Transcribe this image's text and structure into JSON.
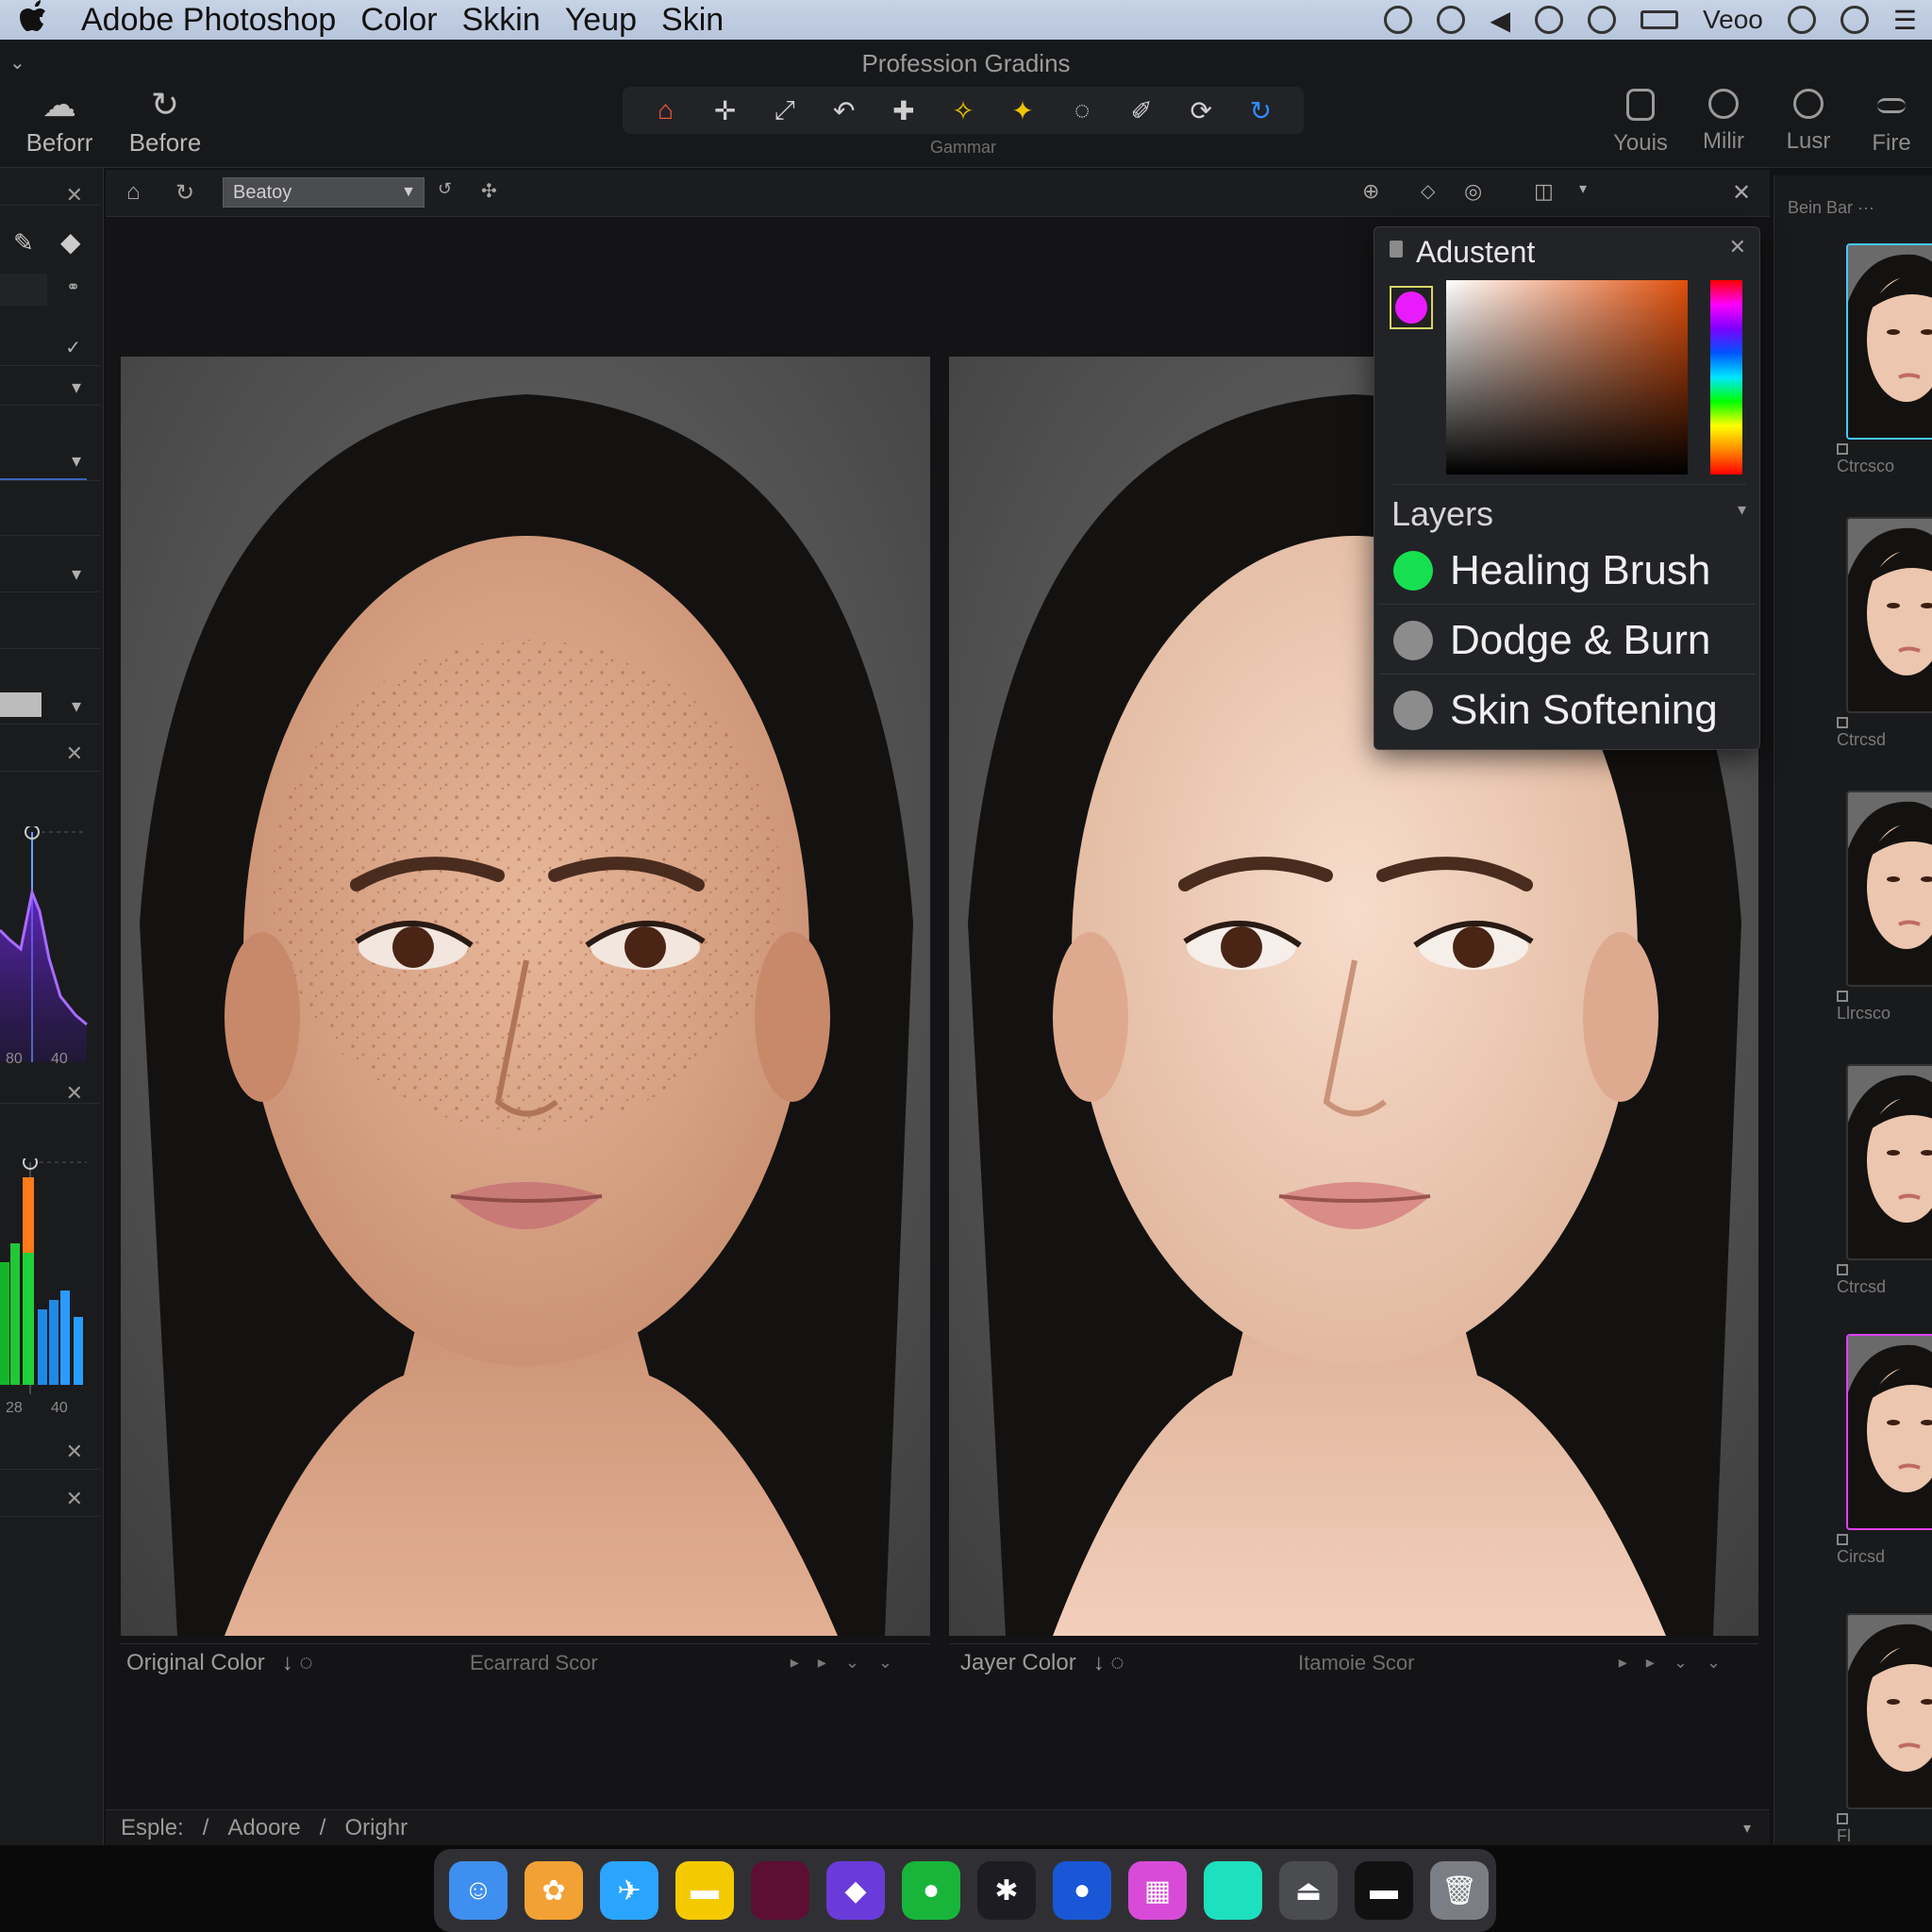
{
  "menubar": {
    "items": [
      "Adobe Photoshop",
      "Color",
      "Skkin",
      "Yeup",
      "Skin"
    ],
    "right_text": "Veoo"
  },
  "app": {
    "title": "Profession Gradins"
  },
  "toolbar": {
    "left_buttons": [
      "Beforr",
      "Before"
    ],
    "strip_label": "Gammar",
    "tools": [
      {
        "icon": "home-tool-icon",
        "color": "#ff5a3c"
      },
      {
        "icon": "move-tool-icon",
        "color": "#d0d0d0"
      },
      {
        "icon": "transform-tool-icon",
        "color": "#d0d0d0"
      },
      {
        "icon": "undo-tool-icon",
        "color": "#d0d0d0"
      },
      {
        "icon": "stamp-tool-icon",
        "color": "#d0d0d0"
      },
      {
        "icon": "spot-heal-tool-icon",
        "color": "#f0c400"
      },
      {
        "icon": "patch-tool-icon",
        "color": "#f0c400"
      },
      {
        "icon": "lasso-tool-icon",
        "color": "#d0d0d0"
      },
      {
        "icon": "pen-tool-icon",
        "color": "#d0d0d0"
      },
      {
        "icon": "rotate-tool-icon",
        "color": "#d0d0d0"
      },
      {
        "icon": "refresh-tool-icon",
        "color": "#2f8cff"
      }
    ],
    "right_buttons": [
      "Youis",
      "Milir",
      "Lusr",
      "Fire"
    ]
  },
  "docbar": {
    "preset_value": "Beatoy"
  },
  "left_panel": {
    "chart1": {
      "ticks": [
        "80",
        "40"
      ],
      "color": "#7b2cff"
    },
    "chart2": {
      "ticks": [
        "28",
        "40"
      ]
    }
  },
  "photos": {
    "left": {
      "caption": "Original Color",
      "caption_icon": "↓ ◌",
      "mid": "Ecarrard Scor"
    },
    "right": {
      "caption": "Jayer Color",
      "caption_icon": "↓ ◌",
      "mid": "Itamoie Scor"
    }
  },
  "breadcrumb": {
    "items": [
      "Esple:",
      "/",
      "Adoore",
      "/",
      "Orighr"
    ]
  },
  "filmstrip": {
    "header": "Bein Bar ···",
    "labels": [
      "Ctrcsco",
      "Ctrcsd",
      "Llrcsco",
      "Ctrcsd",
      "Circsd",
      "Fl"
    ]
  },
  "adjustment": {
    "title": "Adustent",
    "swatch_color": "#e81bff",
    "layers_title": "Layers",
    "layers": [
      {
        "name": "Healing Brush",
        "dot": "#17e050"
      },
      {
        "name": "Dodge & Burn",
        "dot": "#8c8c8c"
      },
      {
        "name": "Skin Softening",
        "dot": "#8c8c8c"
      }
    ]
  },
  "dock": {
    "apps": [
      {
        "icon": "finder-icon",
        "color": "#3f8ff0"
      },
      {
        "icon": "photos-icon",
        "color": "#f2a134"
      },
      {
        "icon": "safari-icon",
        "color": "#2aa5ff"
      },
      {
        "icon": "notes-icon",
        "color": "#f5c900"
      },
      {
        "icon": "app-maroon-icon",
        "color": "#5c0e33"
      },
      {
        "icon": "app-purple-icon",
        "color": "#6a3bd8"
      },
      {
        "icon": "app-green-icon",
        "color": "#19b53b"
      },
      {
        "icon": "app-dark-icon",
        "color": "#1c1c22"
      },
      {
        "icon": "app-blue-icon",
        "color": "#1a57d6"
      },
      {
        "icon": "app-colorful-icon",
        "color": "#d84bd8"
      },
      {
        "icon": "app-teal-icon",
        "color": "#1de0c0"
      },
      {
        "icon": "app-gray-icon",
        "color": "#4a4c50"
      },
      {
        "icon": "app-black-icon",
        "color": "#111111"
      },
      {
        "icon": "trash-icon",
        "color": "#7b7e84"
      }
    ]
  }
}
